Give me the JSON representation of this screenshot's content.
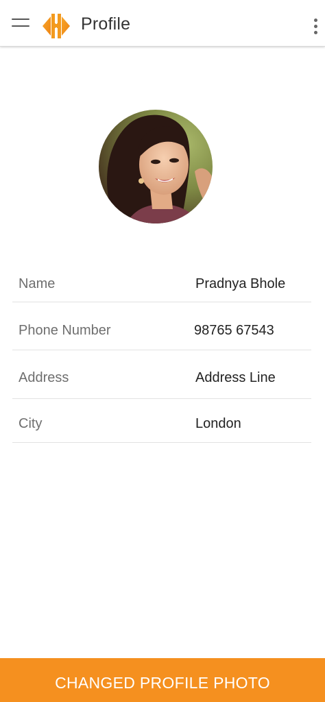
{
  "toolbar": {
    "title": "Profile",
    "menu_icon": "hamburger-menu-icon",
    "logo_icon": "app-logo-h",
    "overflow_icon": "more-vertical-icon"
  },
  "profile": {
    "photo": "profile-photo-woman"
  },
  "details": {
    "rows": [
      {
        "label": "Name",
        "value": "Pradnya Bhole"
      },
      {
        "label": "Phone Number",
        "value": "98765 67543"
      },
      {
        "label": "Address",
        "value": "Address Line"
      },
      {
        "label": "City",
        "value": "London"
      }
    ]
  },
  "actions": {
    "change_photo_label": "CHANGED PROFILE PHOTO"
  },
  "colors": {
    "accent": "#f5901f",
    "logo_orange": "#f39a1e",
    "label_text": "#6e6e6e",
    "value_text": "#222222"
  }
}
